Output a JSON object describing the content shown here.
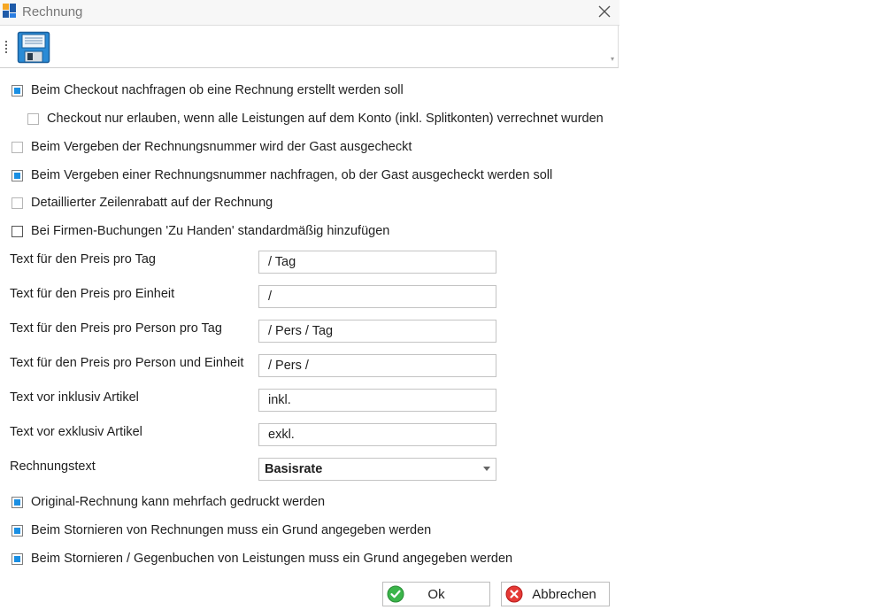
{
  "window": {
    "title": "Rechnung"
  },
  "icons": {
    "app": "app-logo-icon",
    "close": "close-icon",
    "save": "floppy-disk-save-icon",
    "ok": "check-circle-icon",
    "cancel": "cancel-x-icon"
  },
  "checkboxes_top": [
    {
      "label": "Beim Checkout nachfragen ob eine Rechnung erstellt werden soll",
      "checked": true
    },
    {
      "label": "Checkout nur erlauben, wenn alle Leistungen auf dem Konto (inkl. Splitkonten) verrechnet wurden",
      "checked": false
    },
    {
      "label": "Beim Vergeben der Rechnungsnummer wird der Gast ausgecheckt",
      "checked": false
    },
    {
      "label": "Beim Vergeben einer Rechnungsnummer nachfragen, ob der Gast ausgecheckt werden soll",
      "checked": true
    },
    {
      "label": "Detaillierter Zeilenrabatt auf der Rechnung",
      "checked": false
    },
    {
      "label": "Bei Firmen-Buchungen 'Zu Handen' standardmäßig hinzufügen",
      "checked": false
    }
  ],
  "fields": [
    {
      "label": "Text für den Preis pro Tag",
      "value": "/ Tag"
    },
    {
      "label": "Text für den Preis pro Einheit",
      "value": "/"
    },
    {
      "label": "Text für den Preis pro Person pro Tag",
      "value": "/ Pers / Tag"
    },
    {
      "label": "Text für den Preis pro Person und Einheit",
      "value": "/ Pers /"
    },
    {
      "label": "Text vor inklusiv Artikel",
      "value": "inkl."
    },
    {
      "label": "Text vor exklusiv Artikel",
      "value": "exkl."
    }
  ],
  "rechnungstext": {
    "label": "Rechnungstext",
    "value": "Basisrate"
  },
  "checkboxes_bottom": [
    {
      "label": "Original-Rechnung kann mehrfach gedruckt werden",
      "checked": true
    },
    {
      "label": "Beim Stornieren von Rechnungen muss ein Grund angegeben werden",
      "checked": true
    },
    {
      "label": "Beim Stornieren / Gegenbuchen von Leistungen muss ein Grund angegeben werden",
      "checked": true
    }
  ],
  "buttons": {
    "ok": "Ok",
    "cancel": "Abbrechen"
  },
  "colors": {
    "accent": "#1a8fe3",
    "ok_green": "#3bb54a",
    "cancel_red": "#e53935"
  }
}
